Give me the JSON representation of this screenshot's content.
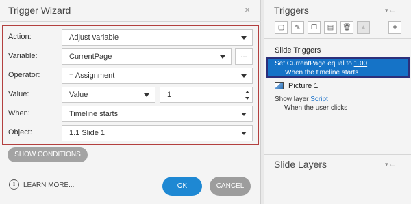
{
  "dialog": {
    "title": "Trigger Wizard",
    "close_glyph": "×",
    "fields": {
      "action": {
        "label": "Action:",
        "value": "Adjust variable"
      },
      "variable": {
        "label": "Variable:",
        "value": "CurrentPage",
        "more_label": "..."
      },
      "operator": {
        "label": "Operator:",
        "value": "= Assignment"
      },
      "value": {
        "label": "Value:",
        "type_value": "Value",
        "number_value": "1"
      },
      "when": {
        "label": "When:",
        "value": "Timeline starts"
      },
      "object": {
        "label": "Object:",
        "value": "1.1 Slide 1"
      }
    },
    "show_conditions": "SHOW CONDITIONS",
    "learn_more": "LEARN MORE...",
    "ok": "OK",
    "cancel": "CANCEL",
    "info_glyph": "i"
  },
  "panel": {
    "triggers_title": "Triggers",
    "slide_triggers_heading": "Slide Triggers",
    "selected_trigger": {
      "prefix": "Set CurrentPage equal to ",
      "value_link": "1.00",
      "condition": "When the timeline starts"
    },
    "picture_item": "Picture 1",
    "picture_trigger": {
      "prefix": "Show layer ",
      "link": "Script",
      "condition": "When the user clicks"
    },
    "slide_layers_title": "Slide Layers",
    "pin_glyph": "▾ ▭"
  },
  "icons": {
    "toolbar": [
      "new-trigger-icon",
      "edit-trigger-icon",
      "copy-trigger-icon",
      "paste-trigger-icon",
      "delete-trigger-icon",
      "move-up-icon",
      "variables-icon"
    ]
  },
  "colors": {
    "selection": "#1573c7",
    "ok_button": "#1e88d3",
    "form_border": "#b3403f"
  }
}
